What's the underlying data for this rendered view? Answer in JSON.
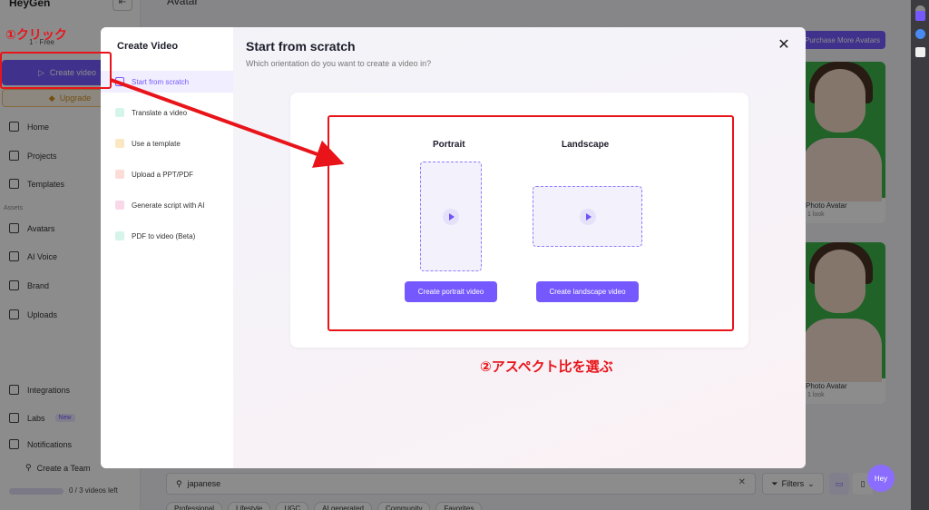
{
  "app": {
    "logo": "HeyGen",
    "collapse_icon": "⇤",
    "plan": "1 · Free",
    "create_label": "Create video",
    "upgrade_label": "Upgrade",
    "nav": [
      "Home",
      "Projects",
      "Templates"
    ],
    "assets_label": "Assets",
    "nav_assets": [
      "Avatars",
      "AI Voice",
      "Brand",
      "Uploads"
    ],
    "nav_bottom": {
      "integrations": "Integrations",
      "labs": "Labs",
      "labs_badge": "New",
      "notifications": "Notifications"
    },
    "team_label": "Create a Team",
    "quota": "0 / 3 videos left",
    "page_title": "Avatar",
    "purchase_label": "Purchase More Avatars",
    "avatars": [
      {
        "name": "Photo Avatar",
        "meta": "1 look"
      },
      {
        "name": "Photo Avatar",
        "meta": "1 look"
      }
    ],
    "search_value": "japanese",
    "filters_label": "Filters",
    "chips": [
      "Professional",
      "Lifestyle",
      "UGC",
      "AI generated",
      "Community",
      "Favorites"
    ],
    "chat_label": "Hey"
  },
  "modal": {
    "left_title": "Create Video",
    "menu": [
      {
        "label": "Start from scratch",
        "icon": "play-outline-icon",
        "color": "#7559ff"
      },
      {
        "label": "Translate a video",
        "icon": "translate-icon",
        "color": "#2fbf8f"
      },
      {
        "label": "Use a template",
        "icon": "template-icon",
        "color": "#f2b441"
      },
      {
        "label": "Upload a PPT/PDF",
        "icon": "document-icon",
        "color": "#f06b5a"
      },
      {
        "label": "Generate script with AI",
        "icon": "ai-script-icon",
        "color": "#e45a9b"
      },
      {
        "label": "PDF to video (Beta)",
        "icon": "pdf-video-icon",
        "color": "#2fbf8f"
      }
    ],
    "title": "Start from scratch",
    "subtitle": "Which orientation do you want to create a video in?",
    "portrait_label": "Portrait",
    "landscape_label": "Landscape",
    "portrait_button": "Create portrait video",
    "landscape_button": "Create landscape video"
  },
  "annotations": {
    "step1": "①クリック",
    "step2": "②アスペクト比を選ぶ",
    "color": "#e8141a"
  }
}
